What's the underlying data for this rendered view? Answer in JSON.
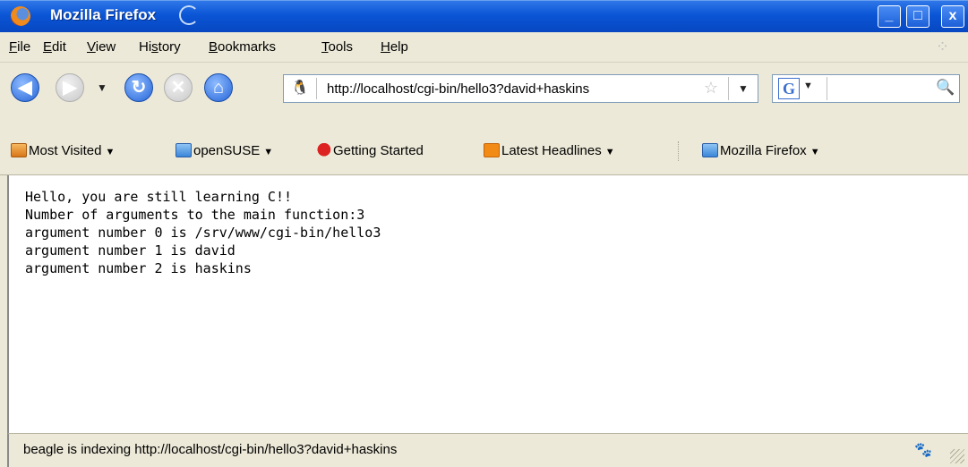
{
  "window": {
    "title": "Mozilla Firefox"
  },
  "title_buttons": {
    "minimize": "_",
    "maximize": "□",
    "close": "x"
  },
  "menu": {
    "items": [
      {
        "label": "File",
        "accel": "F",
        "rest": "ile"
      },
      {
        "label": "Edit",
        "accel": "E",
        "rest": "dit"
      },
      {
        "label": "View",
        "accel": "V",
        "rest": "iew"
      },
      {
        "label": "History",
        "pre": "Hi",
        "accel": "s",
        "rest": "tory"
      },
      {
        "label": "Bookmarks",
        "accel": "B",
        "rest": "ookmarks"
      },
      {
        "label": "Tools",
        "accel": "T",
        "rest": "ools"
      },
      {
        "label": "Help",
        "accel": "H",
        "rest": "elp"
      }
    ]
  },
  "nav": {
    "url": "http://localhost/cgi-bin/hello3?david+haskins",
    "search_placeholder": "",
    "search_engine_glyph": "G"
  },
  "bookmarks": {
    "items": [
      {
        "label": "Most Visited",
        "icon": "most-visited-icon"
      },
      {
        "label": "openSUSE",
        "icon": "folder-icon"
      },
      {
        "label": "Getting Started",
        "icon": "firefox-icon"
      },
      {
        "label": "Latest Headlines",
        "icon": "rss-icon"
      },
      {
        "label": "Mozilla Firefox",
        "icon": "folder-icon"
      }
    ]
  },
  "content": {
    "lines": [
      "Hello, you are still learning C!!",
      "Number of arguments to the main function:3",
      "argument number 0 is /srv/www/cgi-bin/hello3",
      "argument number 1 is david",
      "argument number 2 is haskins"
    ]
  },
  "status": {
    "text": "beagle is indexing http://localhost/cgi-bin/hello3?david+haskins"
  }
}
